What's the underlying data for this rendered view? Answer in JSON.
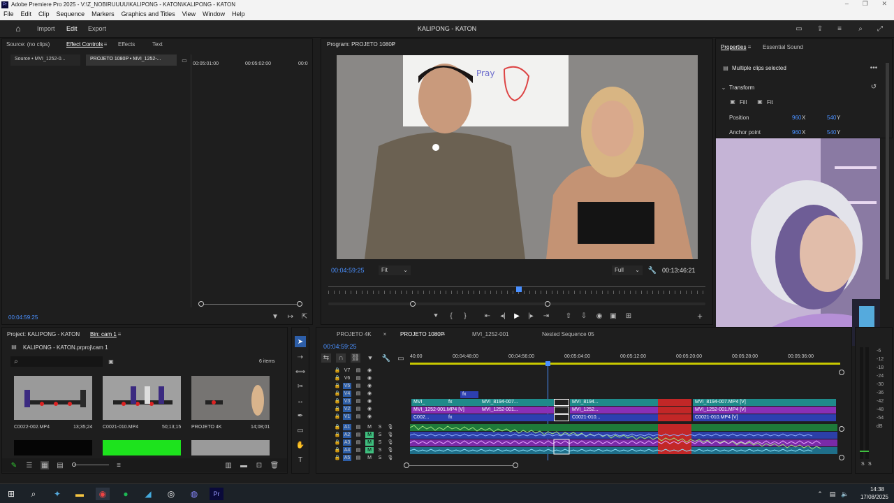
{
  "window": {
    "title": "Adobe Premiere Pro 2025 - V:\\Z_NOBIRUUUU\\KALIPONG - KATON\\KALIPONG - KATON",
    "app_badge": "Pr"
  },
  "menu": [
    "File",
    "Edit",
    "Clip",
    "Sequence",
    "Markers",
    "Graphics and Titles",
    "View",
    "Window",
    "Help"
  ],
  "topbar": {
    "tabs": [
      "Import",
      "Edit",
      "Export"
    ],
    "active": "Edit",
    "project_title": "KALIPONG - KATON"
  },
  "source_panel": {
    "tabs": [
      "Source: (no clips)",
      "Effect Controls",
      "Effects",
      "Text"
    ],
    "active": "Effect Controls",
    "clip_tabs": [
      "Source • MVI_1252-0...",
      "PROJETO 1080P • MVI_1252-..."
    ],
    "ruler": [
      "00:05:01:00",
      "00:05:02:00",
      "00:0"
    ],
    "timecode": "00:04:59:25"
  },
  "program": {
    "title": "Program: PROJETO 1080P",
    "timecode": "00:04:59:25",
    "zoom": "Fit",
    "quality": "Full",
    "duration": "00:13:46:21",
    "whiteboard_text": "Pray"
  },
  "properties": {
    "tabs": [
      "Properties",
      "Essential Sound"
    ],
    "selection": "Multiple clips selected",
    "section": "Transform",
    "fill": "Fill",
    "fit": "Fit",
    "position_label": "Position",
    "position_x": "960",
    "position_y": "540",
    "anchor_label": "Anchor point",
    "anchor_x": "960",
    "anchor_y": "540",
    "x_unit": "X",
    "y_unit": "Y"
  },
  "project": {
    "tab": "Project: KALIPONG - KATON",
    "bin": "Bin: cam 1",
    "file": "KALIPONG - KATON.prproj\\cam 1",
    "items": "6 items",
    "clips": [
      {
        "name": "C0022-002.MP4",
        "dur": "13;35;24"
      },
      {
        "name": "C0021-010.MP4",
        "dur": "50;13;15"
      },
      {
        "name": "PROJETO 4K",
        "dur": "14;08;01"
      }
    ]
  },
  "timeline": {
    "tabs": [
      "PROJETO 4K",
      "PROJETO 1080P",
      "MVI_1252-001",
      "Nested Sequence 05"
    ],
    "active": "PROJETO 1080P",
    "timecode": "00:04:59:25",
    "ruler": [
      "40:00",
      "00:04:48:00",
      "00:04:56:00",
      "00:05:04:00",
      "00:05:12:00",
      "00:05:20:00",
      "00:05:28:00",
      "00:05:36:00"
    ],
    "video_tracks": [
      "V7",
      "V6",
      "V5",
      "V4",
      "V3",
      "V2",
      "V1"
    ],
    "audio_tracks": [
      "A1",
      "A2",
      "A3",
      "A4",
      "A5"
    ],
    "clips_v3": [
      "MVI_",
      "MVI_8194-007...",
      "MVI_8194...",
      "MVI_8194-007.MP4 [V]"
    ],
    "clips_v2": [
      "MVI_1252-001.MP4 [V]",
      "MVI_1252-001...",
      "MVI_1252...",
      "MVI_1252-001.MP4 [V]"
    ],
    "clips_v1": [
      "C002...",
      "C0021-010...",
      "C0021-010.MP4 [V]"
    ],
    "fx": "fx"
  },
  "meter": {
    "scale": [
      "-6",
      "-12",
      "-18",
      "-24",
      "-30",
      "-36",
      "-42",
      "-48",
      "-54",
      "dB"
    ],
    "solo": "S"
  },
  "taskbar": {
    "time": "14:38",
    "date": "17/08/2025"
  }
}
